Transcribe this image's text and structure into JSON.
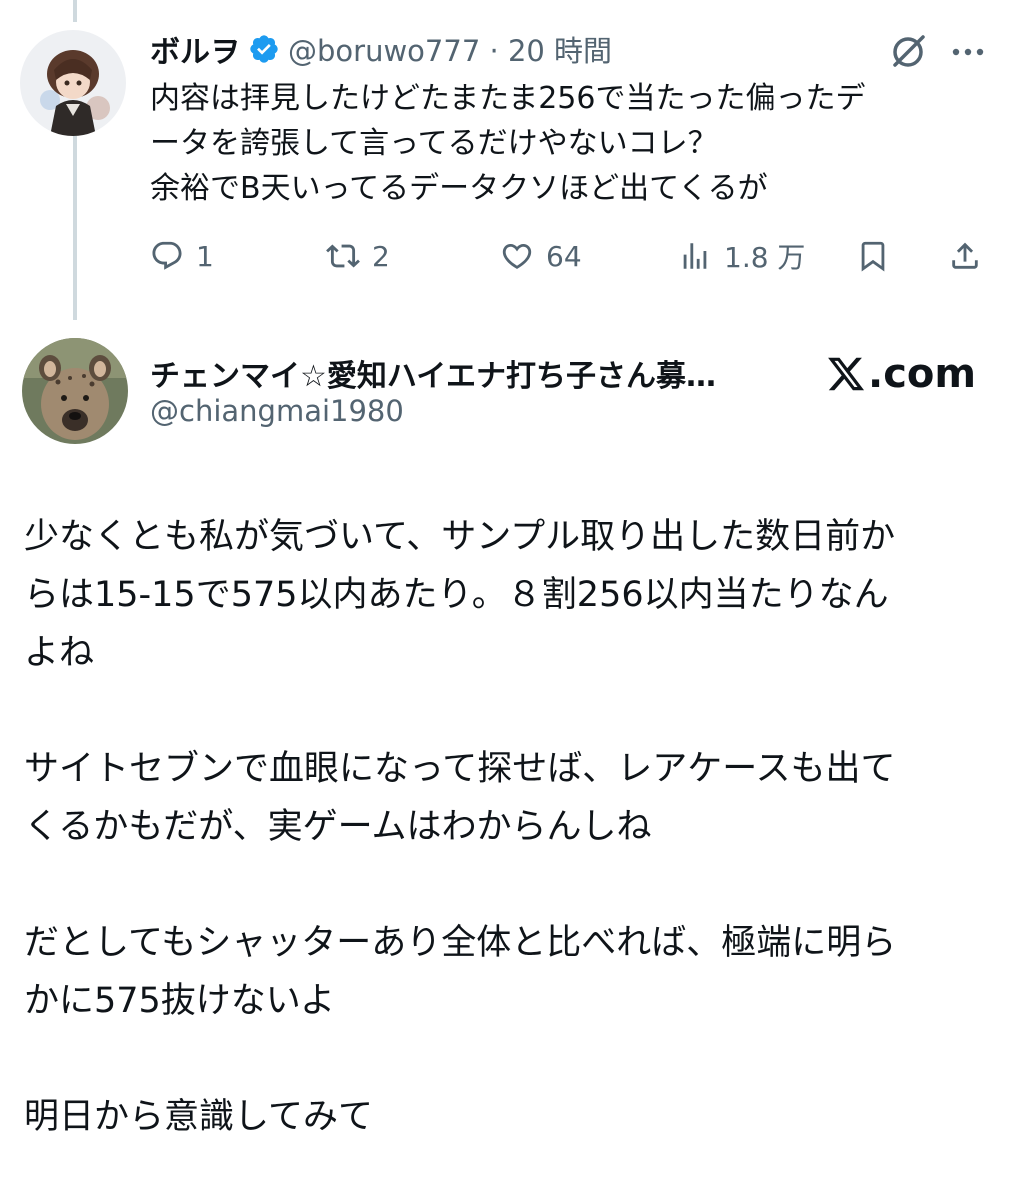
{
  "tweet1": {
    "display_name": "ボルヲ",
    "handle": "@boruwo777",
    "separator": "·",
    "time": "20 時間",
    "text_lines": [
      "内容は拝見したけどたまたま256で当たった偏ったデ",
      "ータを誇張して言ってるだけやないコレ？",
      "余裕でB天いってるデータクソほど出てくるが"
    ],
    "actions": {
      "replies": "1",
      "retweets": "2",
      "likes": "64",
      "views": "1.8 万"
    },
    "icons": [
      "verified-badge-icon",
      "grok-icon",
      "more-icon",
      "reply-icon",
      "retweet-icon",
      "like-icon",
      "views-icon",
      "bookmark-icon",
      "share-icon"
    ]
  },
  "tweet2": {
    "display_name": "チェンマイ☆愛知ハイエナ打ち子さん募…",
    "handle": "@chiangmai1980",
    "brand": "X.com",
    "brand_suffix": ".com",
    "paragraphs": [
      [
        "少なくとも私が気づいて、サンプル取り出した数日前か",
        "らは15-15で575以内あたり。８割256以内当たりなん",
        "よね"
      ],
      [
        "サイトセブンで血眼になって探せば、レアケースも出て",
        "くるかもだが、実ゲームはわからんしね"
      ],
      [
        "だとしてもシャッターあり全体と比べれば、極端に明ら",
        "かに575抜けないよ"
      ],
      [
        "明日から意識してみて"
      ]
    ]
  },
  "colors": {
    "text": "#0f1419",
    "secondary": "#536471",
    "verified": "#1d9bf0",
    "thread_line": "#cfd9de"
  }
}
